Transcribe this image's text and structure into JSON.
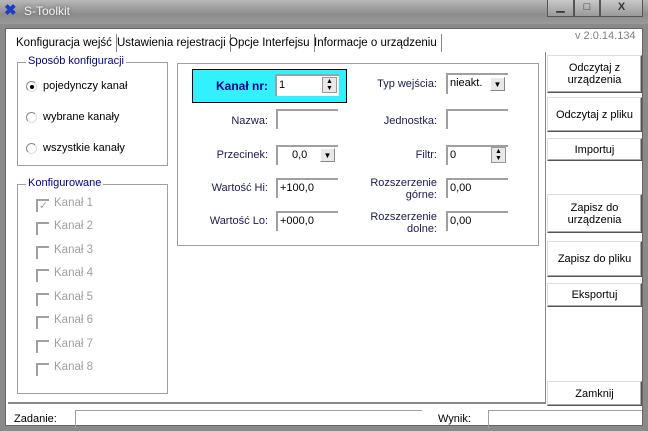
{
  "window": {
    "title": "S-Toolkit",
    "minimize": "▁",
    "maximize": "□",
    "close": "X"
  },
  "tabs": [
    {
      "label": "Konfiguracja wejść",
      "active": true
    },
    {
      "label": "Ustawienia rejestracji"
    },
    {
      "label": "Opcje Interfejsu"
    },
    {
      "label": "Informacje o urządzeniu"
    }
  ],
  "version": "v 2.0.14.134",
  "config_mode": {
    "title": "Sposób konfiguracji",
    "options": [
      {
        "label": "pojedynczy kanał",
        "selected": true
      },
      {
        "label": "wybrane kanały",
        "selected": false
      },
      {
        "label": "wszystkie kanały",
        "selected": false
      }
    ]
  },
  "configured": {
    "title": "Konfigurowane",
    "channels": [
      {
        "label": "Kanał 1",
        "checked": true
      },
      {
        "label": "Kanał 2",
        "checked": false
      },
      {
        "label": "Kanał 3",
        "checked": false
      },
      {
        "label": "Kanał 4",
        "checked": false
      },
      {
        "label": "Kanał 5",
        "checked": false
      },
      {
        "label": "Kanał 6",
        "checked": false
      },
      {
        "label": "Kanał 7",
        "checked": false
      },
      {
        "label": "Kanał 8",
        "checked": false
      }
    ]
  },
  "form": {
    "channel_label": "Kanał nr:",
    "channel_value": "1",
    "input_type_label": "Typ wejścia:",
    "input_type_value": "nieakt.",
    "name_label": "Nazwa:",
    "name_value": "",
    "unit_label": "Jednostka:",
    "unit_value": "",
    "decimal_label": "Przecinek:",
    "decimal_value": "0,0",
    "filter_label": "Filtr:",
    "filter_value": "0",
    "hi_label": "Wartość Hi:",
    "hi_value": "+100,0",
    "ext_upper_label1": "Rozszerzenie",
    "ext_upper_label2": "górne:",
    "ext_upper_value": "0,00",
    "lo_label": "Wartość Lo:",
    "lo_value": "+000,0",
    "ext_lower_label1": "Rozszerzenie",
    "ext_lower_label2": "dolne:",
    "ext_lower_value": "0,00"
  },
  "buttons": {
    "read_device1": "Odczytaj z",
    "read_device2": "urządzenia",
    "read_file": "Odczytaj z pliku",
    "import": "Importuj",
    "save_device1": "Zapisz do",
    "save_device2": "urządzenia",
    "save_file": "Zapisz do pliku",
    "export": "Eksportuj",
    "close": "Zamknij"
  },
  "status": {
    "task_label": "Zadanie:",
    "task_value": "",
    "result_label": "Wynik:",
    "result_value": ""
  }
}
